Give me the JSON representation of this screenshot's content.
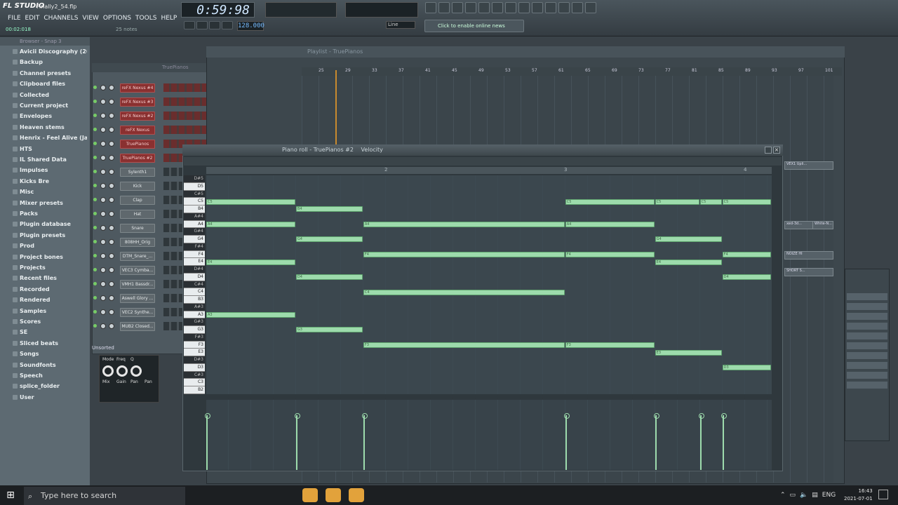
{
  "app": {
    "name": "FL STUDIO",
    "file": "Finally2_54.flp",
    "timecode": "00:02:018",
    "notes": "25 notes",
    "song_time": "0:59:98",
    "tempo": "128.000",
    "snap_line": "Line",
    "online_hint": "Click to enable online news"
  },
  "menu": [
    "FILE",
    "EDIT",
    "CHANNELS",
    "VIEW",
    "OPTIONS",
    "TOOLS",
    "HELP"
  ],
  "browser": {
    "header": "Browser - Snap 3",
    "items": [
      "Avicii Discography (200...",
      "Backup",
      "Channel presets",
      "Clipboard files",
      "Collected",
      "Current project",
      "Envelopes",
      "Heaven stems",
      "Henrix - Feel Alive (Jak...",
      "HTS",
      "IL Shared Data",
      "Impulses",
      "Kicks Bre",
      "Misc",
      "Mixer presets",
      "Packs",
      "Plugin database",
      "Plugin presets",
      "Prod",
      "Project bones",
      "Projects",
      "Recent files",
      "Recorded",
      "Rendered",
      "Samples",
      "Scores",
      "SE",
      "Sliced beats",
      "Songs",
      "Soundfonts",
      "Speech",
      "splice_folder",
      "User"
    ]
  },
  "channel_rack": {
    "title": "TruePianos",
    "group": "Unsorted",
    "channels": [
      "reFX Nexus #4",
      "reFX Nexus #3",
      "reFX Nexus #2",
      "reFX Nexus",
      "TruePianos",
      "TruePianos #2",
      "Sylenth1",
      "Kick",
      "Clap",
      "Hat",
      "Snare",
      "808HH_Orig",
      "DTM_Snare_...",
      "VEC3 Cymba...",
      "VMH1 Bassdr...",
      "Aswell Glory ...",
      "VEC2 Synthe...",
      "MUB2 Closed..."
    ]
  },
  "plugin": {
    "labels": [
      "Mode",
      "Freq",
      "Q",
      "Pan",
      "Mix",
      "Gain",
      "Pan"
    ]
  },
  "playlist": {
    "title": "Playlist - TruePianos",
    "clip_labels": [
      "VEX1 Upli...",
      "xed-3d...",
      "White-N...",
      "NOIZE HI",
      "SHORT S..."
    ],
    "ruler": [
      "25",
      "29",
      "33",
      "37",
      "41",
      "45",
      "49",
      "53",
      "57",
      "61",
      "65",
      "69",
      "73",
      "77",
      "81",
      "85",
      "89",
      "93",
      "97",
      "101"
    ]
  },
  "piano_roll": {
    "title": "Piano roll - TruePianos #2",
    "param": "Velocity",
    "ruler": [
      "2",
      "3",
      "4"
    ],
    "keys": [
      "D#5",
      "D5",
      "C#5",
      "C5",
      "B4",
      "A#4",
      "A4",
      "G#4",
      "G4",
      "F#4",
      "F4",
      "E4",
      "D#4",
      "D4",
      "C#4",
      "C4",
      "B3",
      "A#3",
      "A3",
      "G#3",
      "G3",
      "F#3",
      "F3",
      "E3",
      "D#3",
      "D3",
      "C#3",
      "C3",
      "B2"
    ],
    "notes": [
      {
        "pitch": "C5",
        "start": 0,
        "len": 4
      },
      {
        "pitch": "A4",
        "start": 0,
        "len": 4
      },
      {
        "pitch": "E4",
        "start": 0,
        "len": 4
      },
      {
        "pitch": "A3",
        "start": 0,
        "len": 4
      },
      {
        "pitch": "B4",
        "start": 4,
        "len": 3
      },
      {
        "pitch": "G4",
        "start": 4,
        "len": 3
      },
      {
        "pitch": "D4",
        "start": 4,
        "len": 3
      },
      {
        "pitch": "G3",
        "start": 4,
        "len": 3
      },
      {
        "pitch": "A4",
        "start": 7,
        "len": 9
      },
      {
        "pitch": "F4",
        "start": 7,
        "len": 9
      },
      {
        "pitch": "C4",
        "start": 7,
        "len": 9
      },
      {
        "pitch": "F3",
        "start": 7,
        "len": 9
      },
      {
        "pitch": "C5",
        "start": 16,
        "len": 4
      },
      {
        "pitch": "A4",
        "start": 16,
        "len": 4
      },
      {
        "pitch": "F4",
        "start": 16,
        "len": 4
      },
      {
        "pitch": "F3",
        "start": 16,
        "len": 4
      },
      {
        "pitch": "C5",
        "start": 20,
        "len": 2
      },
      {
        "pitch": "G4",
        "start": 20,
        "len": 3
      },
      {
        "pitch": "E4",
        "start": 20,
        "len": 3
      },
      {
        "pitch": "E3",
        "start": 20,
        "len": 3
      },
      {
        "pitch": "C5",
        "start": 22,
        "len": 1
      },
      {
        "pitch": "C5",
        "start": 23,
        "len": 2.2
      },
      {
        "pitch": "F4",
        "start": 23,
        "len": 2.2
      },
      {
        "pitch": "D4",
        "start": 23,
        "len": 2.2
      },
      {
        "pitch": "D3",
        "start": 23,
        "len": 2.2
      }
    ],
    "velocity_starts": [
      0,
      4,
      7,
      16,
      20,
      22,
      23
    ]
  },
  "taskbar": {
    "search_placeholder": "Type here to search",
    "lang": "ENG",
    "time": "16:43",
    "date": "2021-07-01",
    "icons": [
      "task-view",
      "file-explorer",
      "chrome",
      "telegram",
      "spotify",
      "fl-studio",
      "fl-studio-2",
      "fl-studio-3",
      "live",
      "discord",
      "notes",
      "adobe-app",
      "origin",
      "vlc",
      "settings",
      "steam"
    ]
  }
}
